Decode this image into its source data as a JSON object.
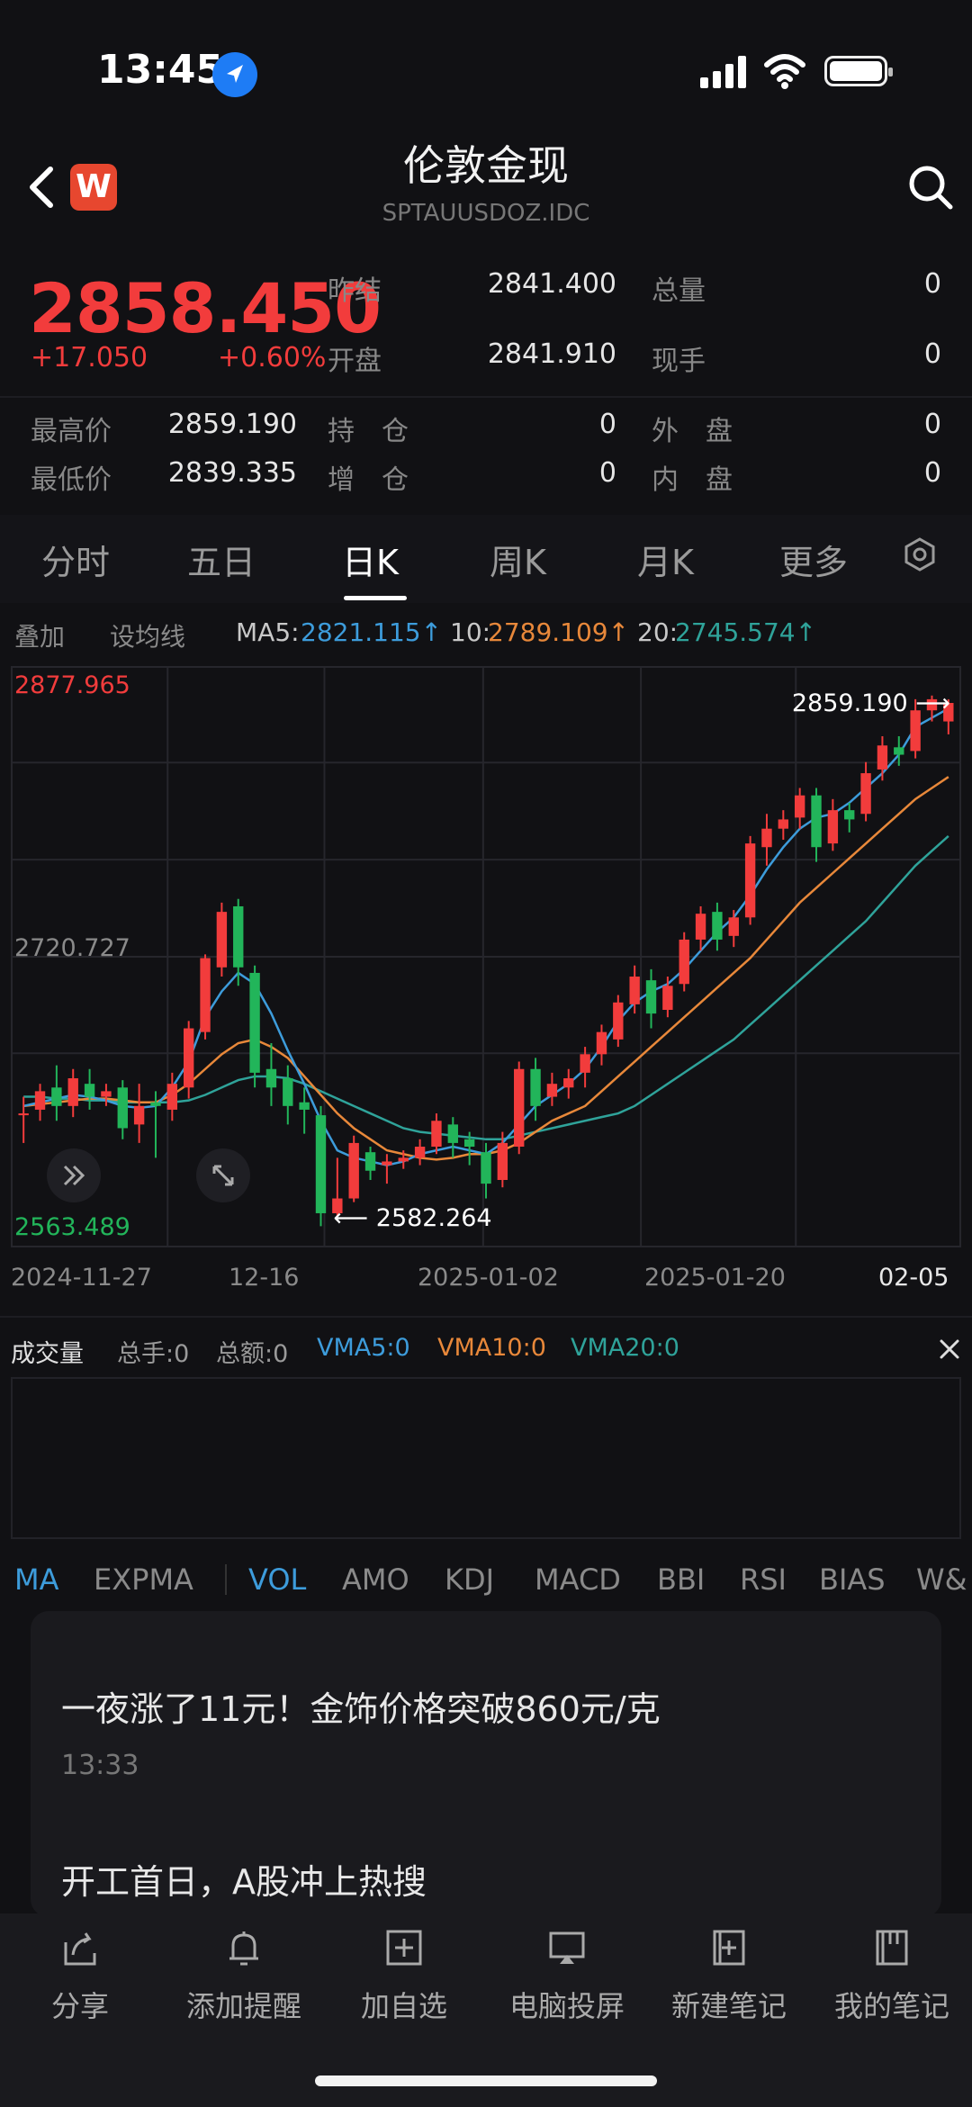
{
  "status": {
    "time": "13:45"
  },
  "header": {
    "title": "伦敦金现",
    "subtitle": "SPTAUUSDOZ.IDC",
    "logo_letter": "W"
  },
  "quote": {
    "price": "2858.450",
    "change": "+17.050",
    "change_pct": "+0.60%",
    "fields": [
      {
        "label": "昨结",
        "value": "2841.400"
      },
      {
        "label": "总量",
        "value": "0"
      },
      {
        "label": "开盘",
        "value": "2841.910"
      },
      {
        "label": "现手",
        "value": "0"
      },
      {
        "label": "最高价",
        "value": "2859.190"
      },
      {
        "label": "持　仓",
        "value": "0"
      },
      {
        "label": "外　盘",
        "value": "0"
      },
      {
        "label": "最低价",
        "value": "2839.335"
      },
      {
        "label": "增　仓",
        "value": "0"
      },
      {
        "label": "内　盘",
        "value": "0"
      }
    ]
  },
  "tabs": [
    "分时",
    "五日",
    "日K",
    "周K",
    "月K",
    "更多"
  ],
  "active_tab": "日K",
  "ma_bar": {
    "overlay": "叠加",
    "set_ma": "设均线",
    "ma5_label": "MA5:",
    "ma5_value": "2821.115↑",
    "ma10_label": "10:",
    "ma10_value": "2789.109↑",
    "ma20_label": "20:",
    "ma20_value": "2745.574↑"
  },
  "chart_data": {
    "type": "candlestick",
    "y_top_label": "2877.965",
    "y_mid_label": "2720.727",
    "y_bottom_label": "2563.489",
    "ylim": [
      2563.489,
      2877.965
    ],
    "high_annotation": "2859.190 ⟶",
    "low_annotation": "⟵ 2582.264",
    "x_labels": [
      "2024-11-27",
      "12-16",
      "2025-01-02",
      "2025-01-20",
      "02-05"
    ],
    "candles": [
      [
        2635,
        2636,
        2620,
        2645
      ],
      [
        2638,
        2648,
        2632,
        2652
      ],
      [
        2650,
        2640,
        2632,
        2662
      ],
      [
        2640,
        2655,
        2634,
        2660
      ],
      [
        2652,
        2645,
        2638,
        2660
      ],
      [
        2645,
        2648,
        2640,
        2652
      ],
      [
        2650,
        2628,
        2622,
        2654
      ],
      [
        2630,
        2640,
        2620,
        2652
      ],
      [
        2642,
        2640,
        2612,
        2648
      ],
      [
        2638,
        2652,
        2632,
        2658
      ],
      [
        2650,
        2682,
        2644,
        2686
      ],
      [
        2680,
        2720,
        2676,
        2722
      ],
      [
        2715,
        2745,
        2710,
        2750
      ],
      [
        2748,
        2715,
        2705,
        2752
      ],
      [
        2712,
        2658,
        2650,
        2716
      ],
      [
        2660,
        2650,
        2640,
        2674
      ],
      [
        2655,
        2640,
        2630,
        2662
      ],
      [
        2642,
        2638,
        2625,
        2650
      ],
      [
        2635,
        2582,
        2575,
        2640
      ],
      [
        2582,
        2590,
        2580,
        2612
      ],
      [
        2590,
        2620,
        2588,
        2624
      ],
      [
        2615,
        2605,
        2600,
        2618
      ],
      [
        2608,
        2610,
        2598,
        2614
      ],
      [
        2610,
        2612,
        2606,
        2616
      ],
      [
        2612,
        2618,
        2608,
        2622
      ],
      [
        2618,
        2632,
        2614,
        2636
      ],
      [
        2630,
        2620,
        2612,
        2634
      ],
      [
        2622,
        2618,
        2608,
        2626
      ],
      [
        2615,
        2598,
        2590,
        2620
      ],
      [
        2600,
        2620,
        2596,
        2626
      ],
      [
        2618,
        2660,
        2614,
        2664
      ],
      [
        2660,
        2640,
        2632,
        2666
      ],
      [
        2645,
        2652,
        2640,
        2658
      ],
      [
        2650,
        2655,
        2644,
        2660
      ],
      [
        2658,
        2668,
        2650,
        2672
      ],
      [
        2668,
        2680,
        2662,
        2684
      ],
      [
        2676,
        2696,
        2672,
        2700
      ],
      [
        2695,
        2710,
        2690,
        2716
      ],
      [
        2708,
        2690,
        2682,
        2714
      ],
      [
        2692,
        2705,
        2688,
        2710
      ],
      [
        2706,
        2730,
        2702,
        2734
      ],
      [
        2730,
        2744,
        2724,
        2748
      ],
      [
        2745,
        2730,
        2724,
        2750
      ],
      [
        2732,
        2742,
        2726,
        2746
      ],
      [
        2742,
        2782,
        2738,
        2786
      ],
      [
        2780,
        2790,
        2770,
        2798
      ],
      [
        2790,
        2795,
        2784,
        2800
      ],
      [
        2796,
        2808,
        2790,
        2812
      ],
      [
        2808,
        2780,
        2772,
        2812
      ],
      [
        2782,
        2800,
        2778,
        2806
      ],
      [
        2800,
        2795,
        2788,
        2804
      ],
      [
        2798,
        2820,
        2794,
        2826
      ],
      [
        2822,
        2835,
        2816,
        2840
      ],
      [
        2834,
        2830,
        2824,
        2840
      ],
      [
        2832,
        2854,
        2828,
        2860
      ],
      [
        2854,
        2860,
        2848,
        2862
      ],
      [
        2848,
        2858,
        2841,
        2860
      ]
    ],
    "ma5": [
      2640,
      2642,
      2644,
      2646,
      2645,
      2643,
      2640,
      2639,
      2640,
      2650,
      2664,
      2688,
      2702,
      2712,
      2706,
      2690,
      2670,
      2652,
      2632,
      2616,
      2612,
      2610,
      2608,
      2610,
      2614,
      2616,
      2618,
      2616,
      2614,
      2620,
      2630,
      2640,
      2646,
      2652,
      2660,
      2672,
      2686,
      2696,
      2702,
      2706,
      2714,
      2724,
      2734,
      2742,
      2754,
      2768,
      2780,
      2790,
      2796,
      2798,
      2804,
      2812,
      2820,
      2830,
      2845,
      2850,
      2855
    ],
    "ma10": [
      2640,
      2641,
      2642,
      2643,
      2644,
      2644,
      2643,
      2642,
      2642,
      2646,
      2652,
      2660,
      2668,
      2674,
      2676,
      2672,
      2666,
      2656,
      2646,
      2636,
      2628,
      2622,
      2616,
      2614,
      2612,
      2611,
      2612,
      2614,
      2614,
      2616,
      2620,
      2626,
      2632,
      2636,
      2640,
      2648,
      2656,
      2664,
      2672,
      2680,
      2688,
      2696,
      2704,
      2712,
      2720,
      2730,
      2740,
      2750,
      2758,
      2766,
      2774,
      2782,
      2790,
      2798,
      2806,
      2812,
      2818
    ],
    "ma20": [
      2645,
      2645,
      2644,
      2644,
      2643,
      2643,
      2642,
      2642,
      2642,
      2642,
      2643,
      2646,
      2650,
      2654,
      2656,
      2656,
      2655,
      2652,
      2648,
      2644,
      2640,
      2636,
      2632,
      2628,
      2626,
      2625,
      2624,
      2623,
      2622,
      2622,
      2624,
      2626,
      2628,
      2630,
      2632,
      2634,
      2636,
      2640,
      2646,
      2652,
      2658,
      2664,
      2670,
      2676,
      2684,
      2692,
      2700,
      2708,
      2716,
      2724,
      2732,
      2740,
      2750,
      2760,
      2770,
      2778,
      2786
    ]
  },
  "volume": {
    "title": "成交量",
    "total_hands": "总手:0",
    "total_amount": "总额:0",
    "vma5": "VMA5:0",
    "vma10": "VMA10:0",
    "vma20": "VMA20:0"
  },
  "indicators": [
    "MA",
    "EXPMA",
    "VOL",
    "AMO",
    "KDJ",
    "MACD",
    "BBI",
    "RSI",
    "BIAS",
    "W&"
  ],
  "news": [
    {
      "title": "一夜涨了11元！金饰价格突破860元/克",
      "time": "13:33"
    },
    {
      "title": "开工首日，A股冲上热搜"
    }
  ],
  "bottom_nav": [
    "分享",
    "添加提醒",
    "加自选",
    "电脑投屏",
    "新建笔记",
    "我的笔记"
  ],
  "colors": {
    "up": "#f23c3c",
    "down": "#22b55a",
    "ma5": "#3d9cdb",
    "ma10": "#e8883a",
    "ma20": "#2fa39a",
    "bg": "#111114"
  }
}
